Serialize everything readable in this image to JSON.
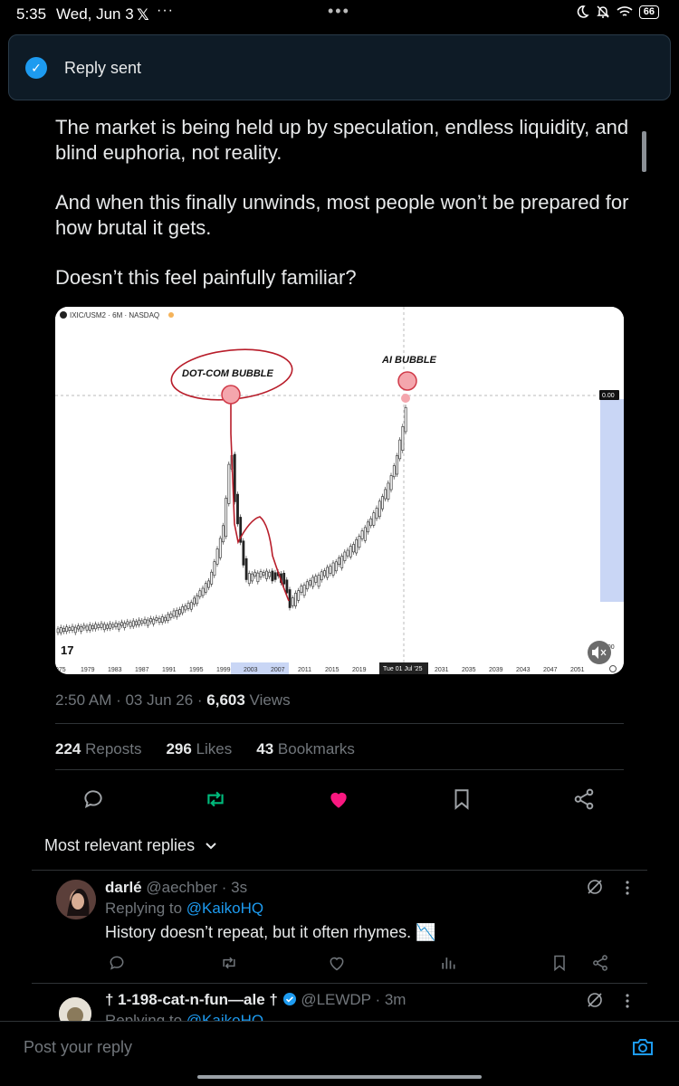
{
  "status_bar": {
    "time": "5:35",
    "date": "Wed, Jun 3",
    "x_app": "𝕏",
    "overflow": "···",
    "center_dots": "•••",
    "battery": "66"
  },
  "toast": {
    "message": "Reply sent"
  },
  "post": {
    "paragraphs": [
      "The market is being held up by speculation, endless liquidity, and blind euphoria, not reality.",
      "And when this finally unwinds, most people won’t be prepared for how brutal it gets.",
      "Doesn’t this feel painfully familiar?"
    ],
    "time": "2:50 AM · 03 Jun 26 · ",
    "views_count": "6,603",
    "views_label": " Views",
    "reposts_count": "224",
    "reposts_label": " Reposts",
    "likes_count": "296",
    "likes_label": " Likes",
    "bookmarks_count": "43",
    "bookmarks_label": " Bookmarks"
  },
  "chart": {
    "symbol": "IXIC/USM2 · 6M · NASDAQ",
    "annotation_left": "DOT-COM BUBBLE",
    "annotation_right": "AI BUBBLE",
    "price_tag": "0.00",
    "price_tag_bottom": "0.00",
    "crosshair_date": "Tue 01 Jul '25",
    "logo": "17",
    "x_ticks": [
      "975",
      "1979",
      "1983",
      "1987",
      "1991",
      "1995",
      "1999",
      "2003",
      "2007",
      "2011",
      "2015",
      "2019",
      "2031",
      "2035",
      "2039",
      "2043",
      "2047",
      "2051"
    ]
  },
  "actions": {
    "reply": "reply-icon",
    "repost": "repost-icon",
    "like": "heart-icon",
    "bookmark": "bookmark-icon",
    "share": "share-icon",
    "repost_color": "#00ba7c",
    "like_color": "#f91880"
  },
  "sort": {
    "label": "Most relevant replies",
    "chevron": "⌄"
  },
  "replies": [
    {
      "name": "darlé",
      "handle": "@aechber · 3s",
      "replying_prefix": "Replying to ",
      "replying_to": "@KaikoHQ",
      "text": "History doesn’t repeat, but it often rhymes. 📉"
    },
    {
      "name": "† 1-198-cat-n-fun—ale †",
      "handle": "@LEWDP · 3m",
      "replying_prefix": "Replying to ",
      "replying_to": "@KaikoHQ"
    }
  ],
  "composer": {
    "placeholder": "Post your reply"
  }
}
